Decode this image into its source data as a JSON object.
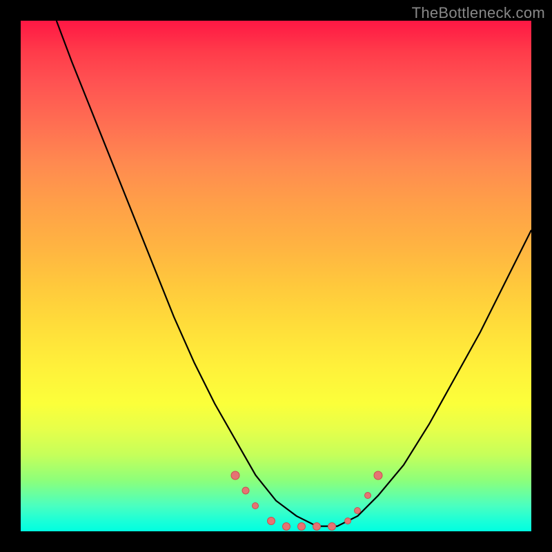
{
  "watermark": "TheBottleneck.com",
  "chart_data": {
    "type": "line",
    "title": "",
    "xlabel": "",
    "ylabel": "",
    "xlim": [
      0,
      100
    ],
    "ylim": [
      0,
      100
    ],
    "grid": false,
    "series": [
      {
        "name": "curve",
        "color": "#000000",
        "x": [
          7,
          10,
          14,
          18,
          22,
          26,
          30,
          34,
          38,
          42,
          46,
          50,
          54,
          58,
          62,
          66,
          70,
          75,
          80,
          85,
          90,
          95,
          100
        ],
        "y": [
          100,
          92,
          82,
          72,
          62,
          52,
          42,
          33,
          25,
          18,
          11,
          6,
          3,
          1,
          1,
          3,
          7,
          13,
          21,
          30,
          39,
          49,
          59
        ]
      }
    ],
    "markers": [
      {
        "x": 42,
        "y": 11,
        "size": 13
      },
      {
        "x": 44,
        "y": 8,
        "size": 11
      },
      {
        "x": 46,
        "y": 5,
        "size": 10
      },
      {
        "x": 49,
        "y": 2,
        "size": 12
      },
      {
        "x": 52,
        "y": 1,
        "size": 12
      },
      {
        "x": 55,
        "y": 1,
        "size": 12
      },
      {
        "x": 58,
        "y": 1,
        "size": 12
      },
      {
        "x": 61,
        "y": 1,
        "size": 12
      },
      {
        "x": 64,
        "y": 2,
        "size": 10
      },
      {
        "x": 66,
        "y": 4,
        "size": 10
      },
      {
        "x": 68,
        "y": 7,
        "size": 10
      },
      {
        "x": 70,
        "y": 11,
        "size": 13
      }
    ],
    "marker_color": "#e57373"
  }
}
